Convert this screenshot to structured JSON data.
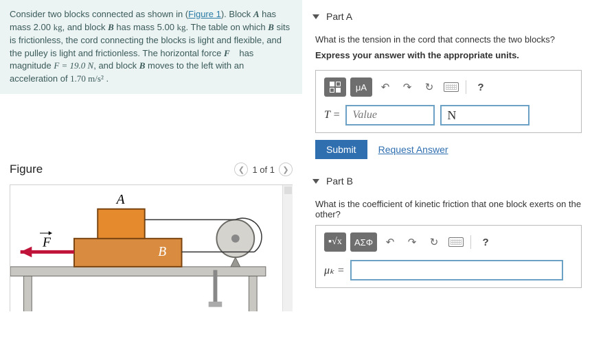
{
  "problem": {
    "html_parts": {
      "p1a": "Consider two blocks connected as shown in (",
      "fig_link": "Figure 1",
      "p1b": "). Block ",
      "A": "A",
      "p1c": " has mass 2.00 ",
      "kg1": "kg",
      "p1d": ", and block ",
      "B": "B",
      "p1e": " has mass 5.00 ",
      "kg2": "kg",
      "p1f": ". The table on which ",
      "B2": "B",
      "p1g": " sits is frictionless, the cord connecting the blocks is light and flexible, and the pulley is light and frictionless. The horizontal force ",
      "Fvec": "F⃗",
      "p1h": " has magnitude ",
      "Feq": "F = 19.0 N",
      "p1i": ", and block ",
      "B3": "B",
      "p1j": " moves to the left with an acceleration of ",
      "accel": "1.70 m/s²",
      "p1k": " ."
    }
  },
  "figure": {
    "title": "Figure",
    "pager": "1 of 1",
    "labels": {
      "A": "A",
      "B": "B",
      "F": "F"
    }
  },
  "partA": {
    "title": "Part A",
    "question": "What is the tension in the cord that connects the two blocks?",
    "instruction": "Express your answer with the appropriate units.",
    "toolbar": {
      "units_btn": "μA"
    },
    "var": "T =",
    "value_placeholder": "Value",
    "units_value": "N",
    "submit": "Submit",
    "request": "Request Answer",
    "help": "?"
  },
  "partB": {
    "title": "Part B",
    "question": "What is the coefficient of kinetic friction that one block exerts on the other?",
    "toolbar": {
      "greek_btn": "ΑΣΦ"
    },
    "var": "μₖ =",
    "help": "?"
  }
}
